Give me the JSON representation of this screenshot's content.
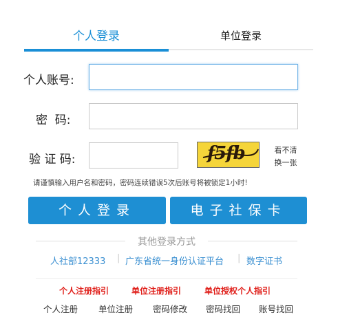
{
  "tabs": {
    "personal": "个人登录",
    "unit": "单位登录"
  },
  "form": {
    "account_label": "个人账号:",
    "password_label": "密  码:",
    "captcha_label": "验 证 码:",
    "account_value": "",
    "password_value": "",
    "captcha_value": "",
    "captcha_image_text": "f5fb",
    "refresh_line1": "看不清",
    "refresh_line2": "换一张"
  },
  "notice": "请谨慎输入用户名和密码，密码连续错误5次后账号将被锁定1小时!",
  "buttons": {
    "login": "个人登录",
    "ecard": "电子社保卡"
  },
  "other_login": {
    "title": "其他登录方式",
    "links": [
      "人社部12333",
      "广东省统一身份认证平台",
      "数字证书"
    ],
    "divider": "|"
  },
  "guides": [
    "个人注册指引",
    "单位注册指引",
    "单位授权个人指引"
  ],
  "bottom_links": [
    "个人注册",
    "单位注册",
    "密码修改",
    "密码找回",
    "账号找回"
  ],
  "colors": {
    "accent": "#1e8fd3",
    "guide_red": "#e0201b",
    "captcha_bg": "#f5d53a"
  }
}
